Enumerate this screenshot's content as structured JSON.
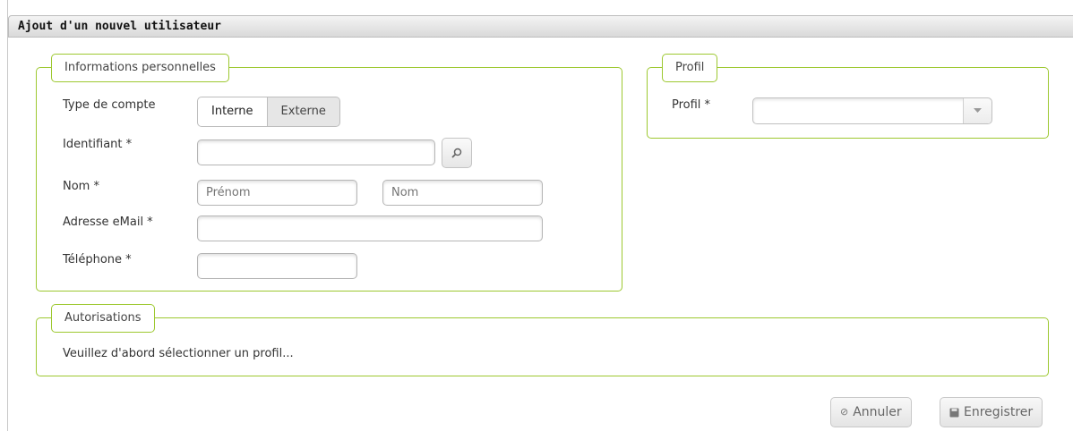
{
  "window": {
    "title": "Ajout d'un nouvel utilisateur"
  },
  "info": {
    "legend": "Informations personnelles",
    "account_type_label": "Type de compte",
    "account_type_options": [
      "Interne",
      "Externe"
    ],
    "account_type_selected": "Interne",
    "identifier_label": "Identifiant *",
    "identifier_value": "",
    "name_label": "Nom *",
    "firstname_placeholder": "Prénom",
    "lastname_placeholder": "Nom",
    "email_label": "Adresse eMail *",
    "phone_label": "Téléphone *"
  },
  "profil": {
    "legend": "Profil",
    "label": "Profil *",
    "selected": ""
  },
  "auth": {
    "legend": "Autorisations",
    "message": "Veuillez d'abord sélectionner un profil..."
  },
  "actions": {
    "cancel_label": "Annuler",
    "save_label": "Enregistrer"
  }
}
